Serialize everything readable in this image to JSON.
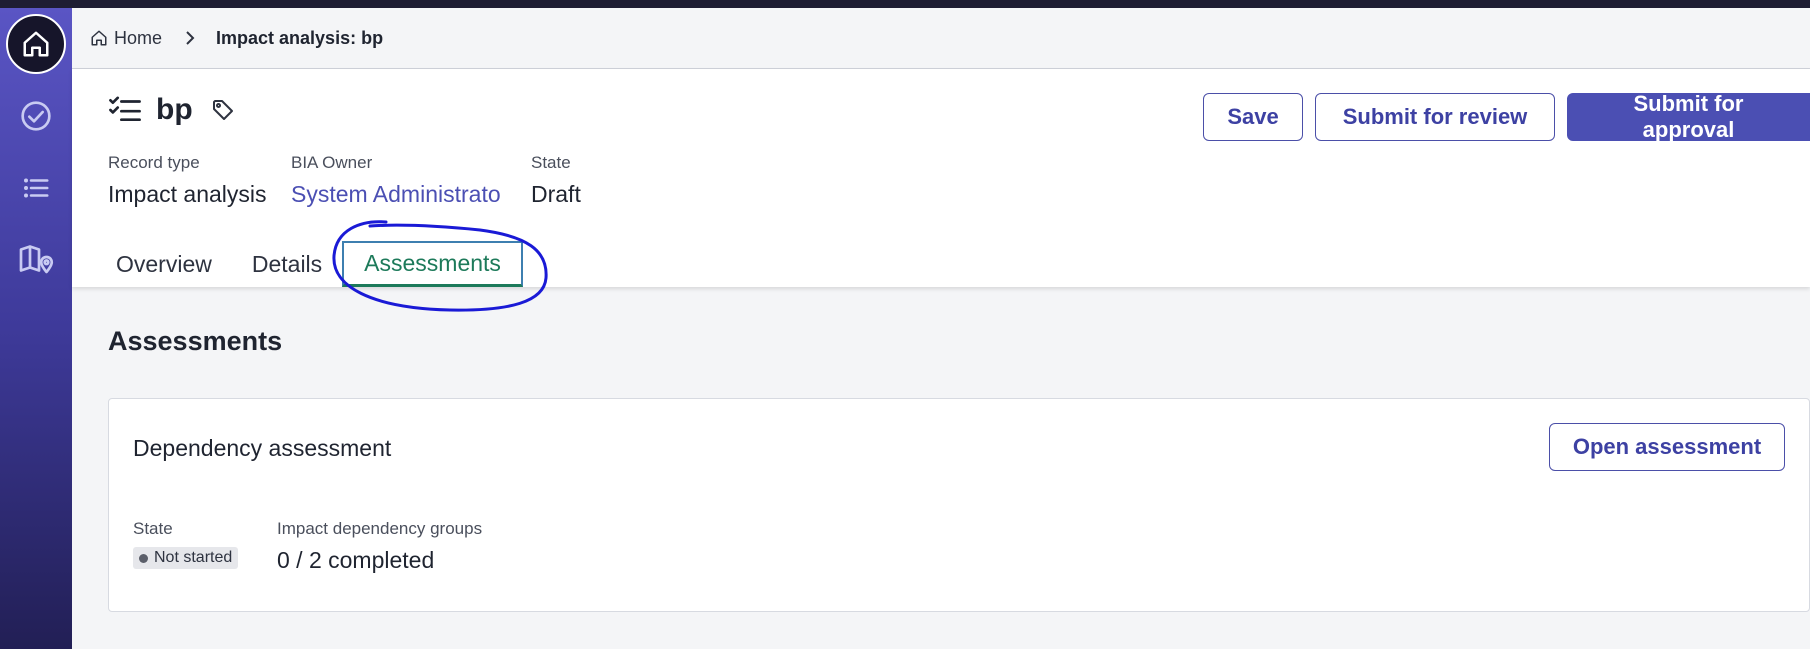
{
  "breadcrumb": {
    "home": "Home",
    "current": "Impact analysis: bp"
  },
  "sidebar": {
    "items": [
      {
        "icon": "home-icon",
        "active": true
      },
      {
        "icon": "check-circle-icon",
        "active": false
      },
      {
        "icon": "list-icon",
        "active": false
      },
      {
        "icon": "map-pin-icon",
        "active": false
      }
    ]
  },
  "record": {
    "title": "bp",
    "fields": [
      {
        "label": "Record type",
        "value": "Impact analysis"
      },
      {
        "label": "BIA Owner",
        "value": "System Administrato"
      },
      {
        "label": "State",
        "value": "Draft"
      }
    ]
  },
  "actions": {
    "save": "Save",
    "submit_review": "Submit for review",
    "submit_approval": "Submit for approval"
  },
  "tabs": [
    {
      "label": "Overview",
      "active": false
    },
    {
      "label": "Details",
      "active": false
    },
    {
      "label": "Assessments",
      "active": true
    }
  ],
  "section": {
    "title": "Assessments"
  },
  "card": {
    "title": "Dependency assessment",
    "open_label": "Open assessment",
    "state_label": "State",
    "state_value": "Not started",
    "groups_label": "Impact dependency groups",
    "groups_value": "0 / 2 completed"
  },
  "colors": {
    "accent": "#4b4fb3",
    "active_tab": "#1d7a5a",
    "annotation": "#1a1ad6"
  }
}
